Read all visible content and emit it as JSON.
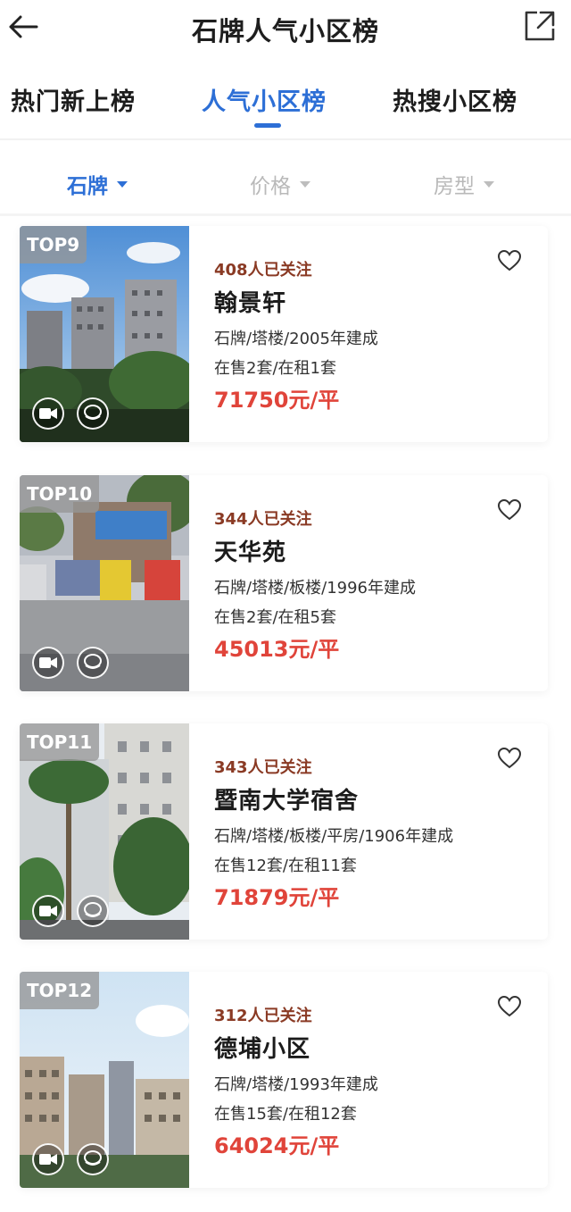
{
  "header": {
    "title": "石牌人气小区榜"
  },
  "tabs": [
    {
      "label": "热门新上榜",
      "active": false
    },
    {
      "label": "人气小区榜",
      "active": true
    },
    {
      "label": "热搜小区榜",
      "active": false
    }
  ],
  "filters": [
    {
      "label": "石牌",
      "active": true
    },
    {
      "label": "价格",
      "active": false
    },
    {
      "label": "房型",
      "active": false
    }
  ],
  "colors": {
    "accent": "#2d6fd6",
    "price": "#e0443a",
    "followers": "#8a3a24"
  },
  "listings": [
    {
      "rank": "TOP9",
      "followers": "408人已关注",
      "name": "翰景轩",
      "meta": "石牌/塔楼/2005年建成",
      "availability": "在售2套/在租1套",
      "price": "71750元/平"
    },
    {
      "rank": "TOP10",
      "followers": "344人已关注",
      "name": "天华苑",
      "meta": "石牌/塔楼/板楼/1996年建成",
      "availability": "在售2套/在租5套",
      "price": "45013元/平"
    },
    {
      "rank": "TOP11",
      "followers": "343人已关注",
      "name": "暨南大学宿舍",
      "meta": "石牌/塔楼/板楼/平房/1906年建成",
      "availability": "在售12套/在租11套",
      "price": "71879元/平"
    },
    {
      "rank": "TOP12",
      "followers": "312人已关注",
      "name": "德埔小区",
      "meta": "石牌/塔楼/1993年建成",
      "availability": "在售15套/在租12套",
      "price": "64024元/平"
    }
  ]
}
